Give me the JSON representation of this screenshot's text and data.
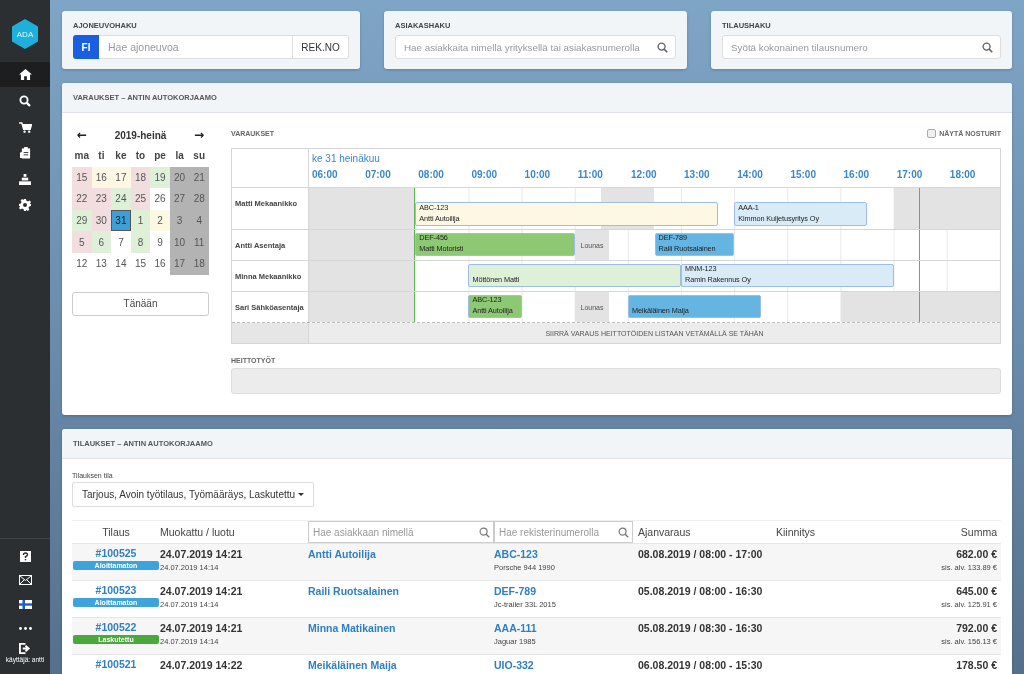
{
  "sidebar": {
    "logo": "ADA",
    "items": [
      {
        "kind": "home",
        "selected": true
      },
      {
        "kind": "search",
        "selected": false
      },
      {
        "kind": "cart",
        "selected": false
      },
      {
        "kind": "clipboard",
        "selected": false
      },
      {
        "kind": "chart",
        "selected": false
      },
      {
        "kind": "settings",
        "selected": false
      }
    ],
    "bottom_items": [
      {
        "kind": "help"
      },
      {
        "kind": "mail"
      },
      {
        "kind": "flag"
      },
      {
        "kind": "more"
      },
      {
        "kind": "logout",
        "label": "käyttäjä: antti"
      }
    ]
  },
  "searches": [
    {
      "title": "AJONEUVOHAKU",
      "prefix": "FI",
      "placeholder": "Hae ajoneuvoa",
      "button": "REK.NO"
    },
    {
      "title": "ASIAKASHAKU",
      "placeholder": "Hae asiakkaita nimellä yrityksellä tai asiakasnumerolla"
    },
    {
      "title": "TILAUSHAKU",
      "placeholder": "Syötä kokonainen tilausnumero"
    }
  ],
  "reservations_panel": {
    "title": "VARAUKSET – ANTIN AUTOKORJAAMO",
    "calendar": {
      "month": "2019-heinä",
      "prev": "←",
      "next": "→",
      "weekdays": [
        "ma",
        "ti",
        "ke",
        "to",
        "pe",
        "la",
        "su"
      ],
      "days": [
        {
          "label": "15",
          "color": "#f2dede",
          "selected": false
        },
        {
          "label": "16",
          "color": "#fcf8e3",
          "selected": false
        },
        {
          "label": "17",
          "color": "#fcf8e3",
          "selected": false
        },
        {
          "label": "18",
          "color": "#f2dede",
          "selected": false
        },
        {
          "label": "19",
          "color": "#dff0d8",
          "selected": false
        },
        {
          "label": "20",
          "color": "#b3b3b3",
          "selected": false
        },
        {
          "label": "21",
          "color": "#b3b3b3",
          "selected": false
        },
        {
          "label": "22",
          "color": "#f2dede",
          "selected": false
        },
        {
          "label": "23",
          "color": "#f2dede",
          "selected": false
        },
        {
          "label": "24",
          "color": "#dff0d8",
          "selected": false
        },
        {
          "label": "25",
          "color": "#f2dede",
          "selected": false
        },
        {
          "label": "26",
          "color": "#ffffff",
          "selected": false
        },
        {
          "label": "27",
          "color": "#b3b3b3",
          "selected": false
        },
        {
          "label": "28",
          "color": "#b3b3b3",
          "selected": false
        },
        {
          "label": "29",
          "color": "#dff0d8",
          "selected": false
        },
        {
          "label": "30",
          "color": "#f2dede",
          "selected": false
        },
        {
          "label": "31",
          "color": "#3c9fd8",
          "selected": true
        },
        {
          "label": "1",
          "color": "#dff0d8",
          "selected": false
        },
        {
          "label": "2",
          "color": "#fcf8e3",
          "selected": false
        },
        {
          "label": "3",
          "color": "#b3b3b3",
          "selected": false
        },
        {
          "label": "4",
          "color": "#b3b3b3",
          "selected": false
        },
        {
          "label": "5",
          "color": "#f2dede",
          "selected": false
        },
        {
          "label": "6",
          "color": "#dff0d8",
          "selected": false
        },
        {
          "label": "7",
          "color": "#ffffff",
          "selected": false
        },
        {
          "label": "8",
          "color": "#dff0d8",
          "selected": false
        },
        {
          "label": "9",
          "color": "#ffffff",
          "selected": false
        },
        {
          "label": "10",
          "color": "#b3b3b3",
          "selected": false
        },
        {
          "label": "11",
          "color": "#b3b3b3",
          "selected": false
        },
        {
          "label": "12",
          "color": "#ffffff",
          "selected": false
        },
        {
          "label": "13",
          "color": "#ffffff",
          "selected": false
        },
        {
          "label": "14",
          "color": "#ffffff",
          "selected": false
        },
        {
          "label": "15",
          "color": "#ffffff",
          "selected": false
        },
        {
          "label": "16",
          "color": "#ffffff",
          "selected": false
        },
        {
          "label": "17",
          "color": "#b3b3b3",
          "selected": false
        },
        {
          "label": "18",
          "color": "#b3b3b3",
          "selected": false
        }
      ],
      "today_button": "Tänään"
    },
    "schedule": {
      "title": "VARAUKSET",
      "show_cranes": {
        "label": "NÄYTÄ NOSTURIT",
        "checked": false
      },
      "date": "ke 31 heinäkuu",
      "hours": [
        "06:00",
        "07:00",
        "08:00",
        "09:00",
        "10:00",
        "11:00",
        "12:00",
        "13:00",
        "14:00",
        "15:00",
        "16:00",
        "17:00",
        "18:00"
      ],
      "rows": [
        {
          "name": "Matti Mekaanikko",
          "blocks": [
            {
              "kind": "lunch"
            },
            {
              "kind": "booking",
              "plate": "ABC-123",
              "customer": "Antti Autoilija",
              "color": "#fcf8e3"
            },
            {
              "kind": "booking",
              "plate": "AAA-1",
              "customer": "Kimmon Kuljetusyritys Oy",
              "color": "#d9ebf7"
            }
          ]
        },
        {
          "name": "Antti Asentaja",
          "blocks": [
            {
              "kind": "booking",
              "plate": "DEF-456",
              "customer": "Matti Motoristi",
              "color": "#8dc873"
            },
            {
              "kind": "lunch",
              "label": "Lounas"
            },
            {
              "kind": "booking",
              "plate": "DEF-789",
              "customer": "Raili Ruotsalainen",
              "color": "#64b5e2"
            }
          ]
        },
        {
          "name": "Minna Mekaanikko",
          "blocks": [
            {
              "kind": "booking",
              "customer": "Möttönen Matti",
              "color": "#dff0d8"
            },
            {
              "kind": "booking",
              "plate": "MNM-123",
              "customer": "Ramin Rakennus Oy",
              "color": "#d9ebf7"
            }
          ]
        },
        {
          "name": "Sari Sähköasentaja",
          "blocks": [
            {
              "kind": "booking",
              "plate": "ABC-123",
              "customer": "Antti Autoilija",
              "color": "#8dc873"
            },
            {
              "kind": "lunch",
              "label": "Lounas"
            },
            {
              "kind": "booking",
              "customer": "Meikäläinen Maija",
              "color": "#64b5e2"
            }
          ]
        }
      ],
      "drop_hint": "SIIRRÄ VARAUS HEITTOTÖIDEN LISTAAN VETÄMÄLLÄ SE TÄHÄN"
    },
    "backlog": {
      "title": "HEITTOTYÖT"
    }
  },
  "orders_panel": {
    "title": "TILAUKSET – ANTIN AUTOKORJAAMO",
    "filter": {
      "label": "Tilauksen tila",
      "value": "Tarjous, Avoin työtilaus, Työmääräys, Laskutettu"
    },
    "columns": {
      "order": "Tilaus",
      "modified": "Muokattu / luotu",
      "customer_search": {
        "placeholder": "Hae asiakkaan nimellä"
      },
      "plate_search": {
        "placeholder": "Hae rekisterinumerolla"
      },
      "booking": "Ajanvaraus",
      "pin": "Kiinnitys",
      "sum": "Summa"
    },
    "rows": [
      {
        "order": "#100525",
        "status": {
          "label": "Aloittamaton",
          "color": "#3fa3db"
        },
        "modified": "24.07.2019 14:21",
        "created": "24.07.2019 14:14",
        "customer": "Antti Autoilija",
        "plate": "ABC-123",
        "vehicle": "Porsche 944 1990",
        "booking": "08.08.2019 / 08:00 - 17:00",
        "sum": "682.00 €",
        "vat": "sis. alv. 133.89 €"
      },
      {
        "order": "#100523",
        "status": {
          "label": "Aloittamaton",
          "color": "#3fa3db"
        },
        "modified": "24.07.2019 14:21",
        "created": "24.07.2019 14:14",
        "customer": "Raili Ruotsalainen",
        "plate": "DEF-789",
        "vehicle": "Jc-trailer 33L 2015",
        "booking": "05.08.2019 / 08:00 - 16:30",
        "sum": "645.00 €",
        "vat": "sis. alv. 125.91 €"
      },
      {
        "order": "#100522",
        "status": {
          "label": "Laskutettu",
          "color": "#4ca83d"
        },
        "modified": "24.07.2019 14:21",
        "created": "24.07.2019 14:14",
        "customer": "Minna Matikainen",
        "plate": "AAA-111",
        "vehicle": "Jaguar 1985",
        "booking": "05.08.2019 / 08:30 - 16:30",
        "sum": "792.00 €",
        "vat": "sis. alv. 156.13 €"
      },
      {
        "order": "#100521",
        "modified": "24.07.2019 14:22",
        "customer": "Meikäläinen Maija",
        "plate": "UIO-332",
        "booking": "06.08.2019 / 08:00 - 15:30",
        "sum": "178.50 €"
      }
    ]
  }
}
